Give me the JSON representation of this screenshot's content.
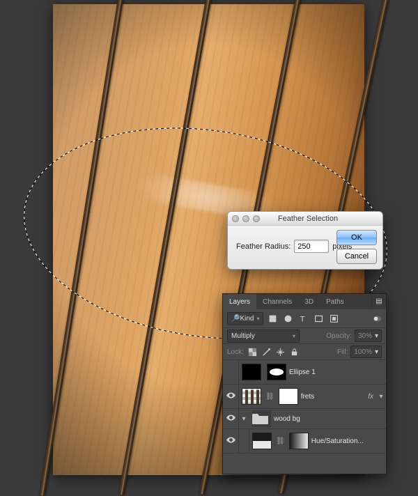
{
  "dialog": {
    "title": "Feather Selection",
    "label": "Feather Radius:",
    "value": "250",
    "units": "pixels",
    "ok": "OK",
    "cancel": "Cancel"
  },
  "panel": {
    "tabs": {
      "layers": "Layers",
      "channels": "Channels",
      "threeD": "3D",
      "paths": "Paths"
    },
    "filterKind": "Kind",
    "blendMode": "Multiply",
    "opacityLabel": "Opacity:",
    "opacityValue": "30%",
    "lockLabel": "Lock:",
    "fillLabel": "Fill:",
    "fillValue": "100%",
    "layers": {
      "ellipse": "Ellipse 1",
      "frets": "frets",
      "fx": "fx",
      "woodbg": "wood bg",
      "huesat": "Hue/Saturation..."
    }
  },
  "chart_data": {
    "type": "none"
  }
}
